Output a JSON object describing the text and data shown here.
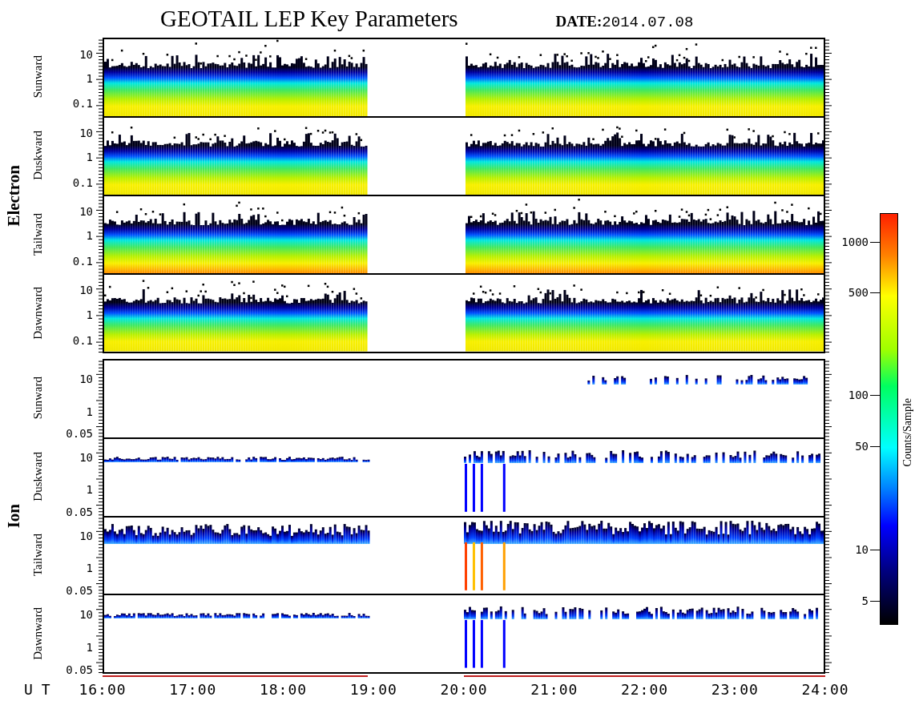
{
  "title": "GEOTAIL LEP Key Parameters",
  "date": {
    "label": "DATE:",
    "value": "2014.07.08"
  },
  "groups": [
    {
      "name": "Electron",
      "kind": "electron",
      "panels": [
        {
          "label": "Sunward",
          "yticks": [
            "10",
            "1",
            "0.1"
          ]
        },
        {
          "label": "Duskward",
          "yticks": [
            "10",
            "1",
            "0.1"
          ]
        },
        {
          "label": "Tailward",
          "yticks": [
            "10",
            "1",
            "0.1"
          ]
        },
        {
          "label": "Dawnward",
          "yticks": [
            "10",
            "1",
            "0.1"
          ]
        }
      ]
    },
    {
      "name": "Ion",
      "kind": "ion",
      "panels": [
        {
          "label": "Sunward",
          "yticks": [
            "10",
            "1",
            "0.05"
          ]
        },
        {
          "label": "Duskward",
          "yticks": [
            "10",
            "1",
            "0.05"
          ]
        },
        {
          "label": "Tailward",
          "yticks": [
            "10",
            "1",
            "0.05"
          ]
        },
        {
          "label": "Dawnward",
          "yticks": [
            "10",
            "1",
            "0.05"
          ]
        }
      ]
    }
  ],
  "xaxis": {
    "label": "U T",
    "ticks": [
      "16:00",
      "17:00",
      "18:00",
      "19:00",
      "20:00",
      "21:00",
      "22:00",
      "23:00",
      "24:00"
    ]
  },
  "colorbar": {
    "label": "Counts/Sample",
    "ticks": [
      "1000",
      "500",
      "100",
      "50",
      "10",
      "5"
    ]
  }
}
